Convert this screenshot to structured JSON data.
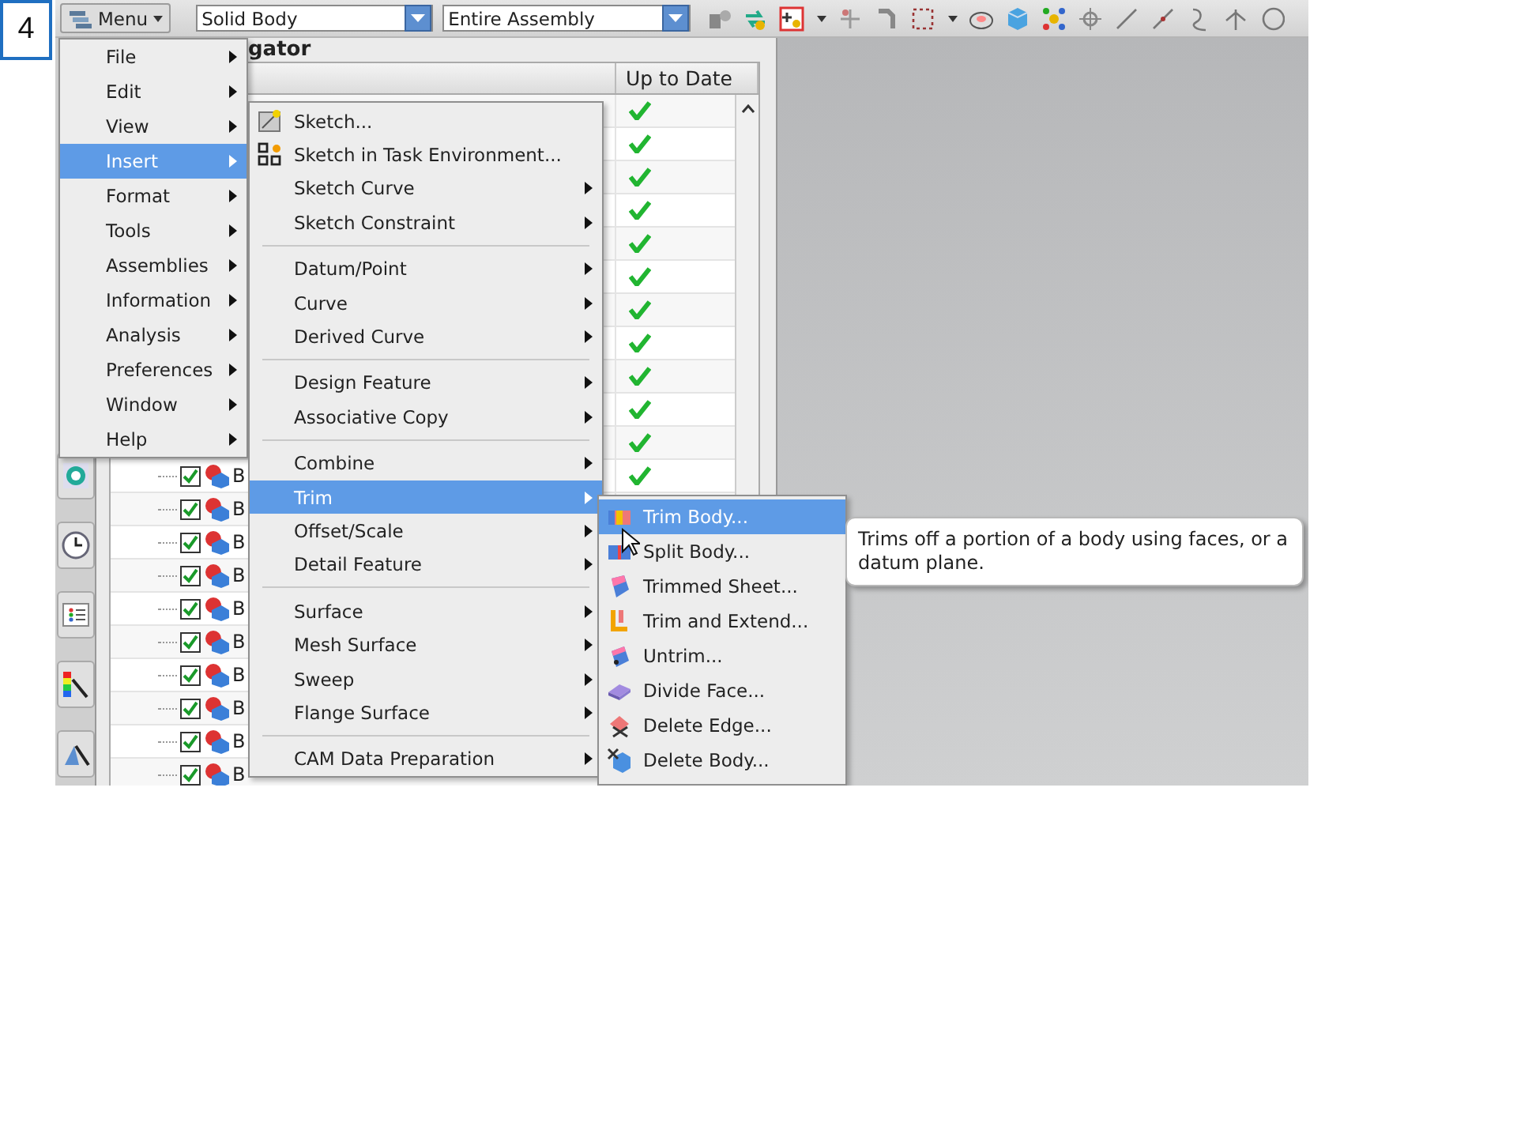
{
  "slide_number": "4",
  "toolbar": {
    "menu_button": "Menu",
    "selection_filter": "Solid Body",
    "selection_scope": "Entire Assembly"
  },
  "navigator": {
    "title": "gator",
    "columns": [
      "Up to Date"
    ],
    "rows": [
      {
        "up_to_date": true
      },
      {
        "up_to_date": true
      },
      {
        "up_to_date": true
      },
      {
        "up_to_date": true
      },
      {
        "up_to_date": true
      },
      {
        "up_to_date": true
      },
      {
        "up_to_date": true
      },
      {
        "up_to_date": true
      },
      {
        "up_to_date": true
      },
      {
        "up_to_date": true
      },
      {
        "up_to_date": true
      },
      {
        "up_to_date": true,
        "checked": true,
        "name": "B"
      },
      {
        "checked": true,
        "name": "B"
      },
      {
        "checked": true,
        "name": "B"
      },
      {
        "checked": true,
        "name": "B"
      },
      {
        "checked": true,
        "name": "B"
      },
      {
        "checked": true,
        "name": "B"
      },
      {
        "checked": true,
        "name": "B"
      },
      {
        "checked": true,
        "name": "B"
      },
      {
        "checked": true,
        "name": "B"
      },
      {
        "checked": true,
        "name": "B"
      }
    ]
  },
  "main_menu": {
    "items": [
      {
        "kind": "item",
        "label": "File",
        "has_submenu": true,
        "selected": false
      },
      {
        "kind": "item",
        "label": "Edit",
        "has_submenu": true,
        "selected": false
      },
      {
        "kind": "item",
        "label": "View",
        "has_submenu": true,
        "selected": false
      },
      {
        "kind": "item",
        "label": "Insert",
        "has_submenu": true,
        "selected": true
      },
      {
        "kind": "item",
        "label": "Format",
        "has_submenu": true,
        "selected": false
      },
      {
        "kind": "item",
        "label": "Tools",
        "has_submenu": true,
        "selected": false
      },
      {
        "kind": "item",
        "label": "Assemblies",
        "has_submenu": true,
        "selected": false
      },
      {
        "kind": "item",
        "label": "Information",
        "has_submenu": true,
        "selected": false
      },
      {
        "kind": "item",
        "label": "Analysis",
        "has_submenu": true,
        "selected": false
      },
      {
        "kind": "item",
        "label": "Preferences",
        "has_submenu": true,
        "selected": false
      },
      {
        "kind": "item",
        "label": "Window",
        "has_submenu": true,
        "selected": false
      },
      {
        "kind": "item",
        "label": "Help",
        "has_submenu": true,
        "selected": false
      }
    ]
  },
  "insert_menu": {
    "items": [
      {
        "kind": "icon-item",
        "label": "Sketch...",
        "has_submenu": false,
        "selected": false
      },
      {
        "kind": "icon-item",
        "label": "Sketch in Task Environment...",
        "has_submenu": false,
        "selected": false
      },
      {
        "kind": "item",
        "label": "Sketch Curve",
        "has_submenu": true,
        "selected": false
      },
      {
        "kind": "item",
        "label": "Sketch Constraint",
        "has_submenu": true,
        "selected": false
      },
      {
        "kind": "separator"
      },
      {
        "kind": "item",
        "label": "Datum/Point",
        "has_submenu": true,
        "selected": false
      },
      {
        "kind": "item",
        "label": "Curve",
        "has_submenu": true,
        "selected": false
      },
      {
        "kind": "item",
        "label": "Derived Curve",
        "has_submenu": true,
        "selected": false
      },
      {
        "kind": "separator"
      },
      {
        "kind": "item",
        "label": "Design Feature",
        "has_submenu": true,
        "selected": false
      },
      {
        "kind": "item",
        "label": "Associative Copy",
        "has_submenu": true,
        "selected": false
      },
      {
        "kind": "separator"
      },
      {
        "kind": "item",
        "label": "Combine",
        "has_submenu": true,
        "selected": false
      },
      {
        "kind": "item",
        "label": "Trim",
        "has_submenu": true,
        "selected": true
      },
      {
        "kind": "item",
        "label": "Offset/Scale",
        "has_submenu": true,
        "selected": false
      },
      {
        "kind": "item",
        "label": "Detail Feature",
        "has_submenu": true,
        "selected": false
      },
      {
        "kind": "separator"
      },
      {
        "kind": "item",
        "label": "Surface",
        "has_submenu": true,
        "selected": false
      },
      {
        "kind": "item",
        "label": "Mesh Surface",
        "has_submenu": true,
        "selected": false
      },
      {
        "kind": "item",
        "label": "Sweep",
        "has_submenu": true,
        "selected": false
      },
      {
        "kind": "item",
        "label": "Flange Surface",
        "has_submenu": true,
        "selected": false
      },
      {
        "kind": "separator"
      },
      {
        "kind": "item",
        "label": "CAM Data Preparation",
        "has_submenu": true,
        "selected": false
      }
    ]
  },
  "trim_menu": {
    "items": [
      {
        "kind": "icon-item",
        "label": "Trim Body...",
        "has_submenu": false,
        "selected": true
      },
      {
        "kind": "icon-item",
        "label": "Split Body...",
        "has_submenu": false,
        "selected": false
      },
      {
        "kind": "icon-item",
        "label": "Trimmed Sheet...",
        "has_submenu": false,
        "selected": false
      },
      {
        "kind": "icon-item",
        "label": "Trim and Extend...",
        "has_submenu": false,
        "selected": false
      },
      {
        "kind": "icon-item",
        "label": "Untrim...",
        "has_submenu": false,
        "selected": false
      },
      {
        "kind": "icon-item",
        "label": "Divide Face...",
        "has_submenu": false,
        "selected": false
      },
      {
        "kind": "icon-item",
        "label": "Delete Edge...",
        "has_submenu": false,
        "selected": false
      },
      {
        "kind": "icon-item",
        "label": "Delete Body...",
        "has_submenu": false,
        "selected": false
      }
    ]
  },
  "tooltip": "Trims off a portion of a body using faces, or a datum plane."
}
